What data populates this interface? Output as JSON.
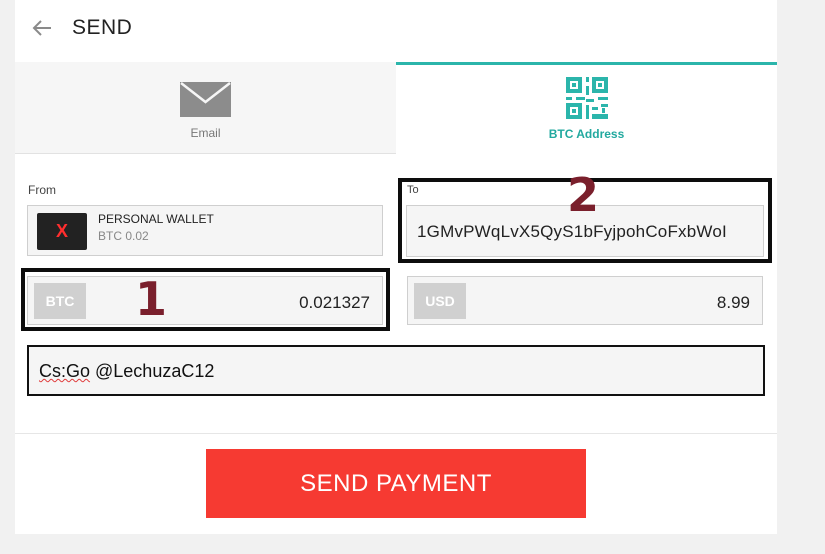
{
  "header": {
    "title": "SEND",
    "back_icon": "arrow-left-icon"
  },
  "tabs": [
    {
      "label": "Email",
      "icon": "mail-icon",
      "active": false
    },
    {
      "label": "BTC Address",
      "icon": "qr-code-icon",
      "active": true
    }
  ],
  "from": {
    "label": "From",
    "wallet_name": "PERSONAL WALLET",
    "wallet_balance": "BTC 0.02",
    "logo_glyph": "X"
  },
  "to": {
    "label": "To",
    "address": "1GMvPWqLvX5QyS1bFyjpohCoFxbWoI"
  },
  "amount": {
    "btc": {
      "currency": "BTC",
      "value": "0.021327"
    },
    "usd": {
      "currency": "USD",
      "value": "8.99"
    }
  },
  "note": {
    "prefix": "Cs:Go",
    "rest": " @LechuzaC12"
  },
  "send_button": {
    "label": "SEND PAYMENT"
  },
  "annotations": {
    "one": "1",
    "two": "2"
  },
  "colors": {
    "accent": "#2bb5ab",
    "button": "#f63a32",
    "annotation_number": "#7a1f2c",
    "logo_x": "#ff2e2e"
  }
}
